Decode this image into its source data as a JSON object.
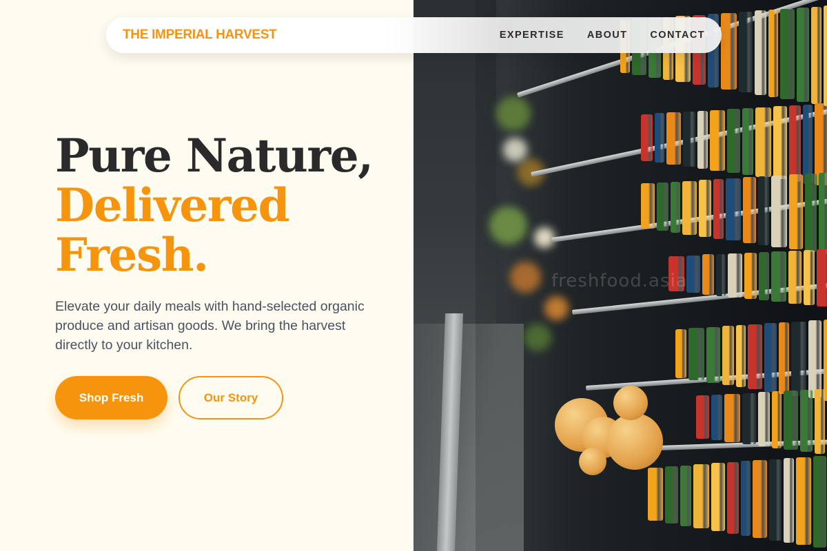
{
  "nav": {
    "brand": "THE IMPERIAL HARVEST",
    "links": [
      "EXPERTISE",
      "ABOUT",
      "CONTACT"
    ]
  },
  "hero": {
    "title_line1": "Pure Nature,",
    "title_line2": "Delivered",
    "title_line3": "Fresh.",
    "description": "Elevate your daily meals with hand-selected organic produce and artisan goods. We bring the harvest directly to your kitchen.",
    "primary_button": "Shop Fresh",
    "secondary_button": "Our Story"
  },
  "image": {
    "subject": "supermarket-refrigerated-aisle",
    "watermark": "freshfood.asia"
  },
  "colors": {
    "accent": "#f7940e",
    "background": "#fefcf1",
    "heading": "#2a2a2a",
    "body_text": "#4a5160"
  }
}
